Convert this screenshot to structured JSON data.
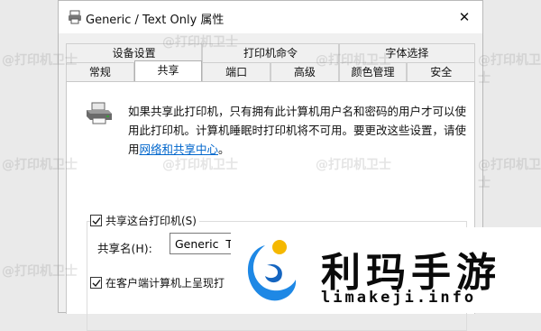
{
  "window": {
    "title": "Generic / Text Only 属性",
    "close_glyph": "✕"
  },
  "tabs": {
    "row1": [
      {
        "label": "设备设置",
        "name": "tab-device-settings"
      },
      {
        "label": "打印机命令",
        "name": "tab-printer-commands"
      },
      {
        "label": "字体选择",
        "name": "tab-font-selection"
      }
    ],
    "row2": [
      {
        "label": "常规",
        "name": "tab-general"
      },
      {
        "label": "共享",
        "name": "tab-sharing",
        "active": true
      },
      {
        "label": "端口",
        "name": "tab-ports"
      },
      {
        "label": "高级",
        "name": "tab-advanced"
      },
      {
        "label": "颜色管理",
        "name": "tab-color-management"
      },
      {
        "label": "安全",
        "name": "tab-security"
      }
    ]
  },
  "sharing": {
    "description": "如果共享此打印机，只有拥有此计算机用户名和密码的用户才可以使用此打印机。计算机睡眠时打印机将不可用。要更改这些设置，请使用",
    "link_text": "网络和共享中心",
    "link_suffix": "。",
    "share_checkbox_label": "共享这台打印机(S)",
    "share_checked": true,
    "share_name_label": "共享名(H):",
    "share_name_value": "Generic  Te",
    "render_checkbox_label": "在客户端计算机上呈现打",
    "render_checked": true
  },
  "watermark_text": "@打印机卫士",
  "promo": {
    "brand": "利玛手游",
    "url": "limakeji.info"
  },
  "colors": {
    "link": "#0066cc",
    "logo_blue": "#1e88e5",
    "logo_yellow": "#f5b800"
  },
  "icons": {
    "title": "printer-icon",
    "close": "close-icon",
    "checkbox": "checkmark-icon",
    "promo_logo": "moon-swirl-logo"
  }
}
